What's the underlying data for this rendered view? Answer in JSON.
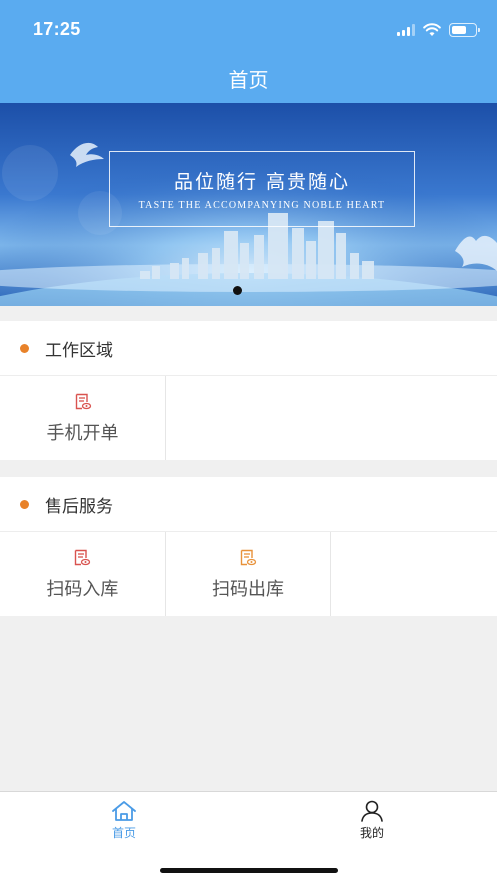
{
  "status_bar": {
    "time": "17:25"
  },
  "header": {
    "title": "首页"
  },
  "banner": {
    "title_cn": "品位随行  高贵随心",
    "subtitle_en": "TASTE THE ACCOMPANYING NOBLE HEART"
  },
  "sections": [
    {
      "title": "工作区域",
      "items": [
        {
          "label": "手机开单",
          "icon": "document-view-icon",
          "icon_color": "#d9534f"
        }
      ]
    },
    {
      "title": "售后服务",
      "items": [
        {
          "label": "扫码入库",
          "icon": "document-view-icon",
          "icon_color": "#d9534f"
        },
        {
          "label": "扫码出库",
          "icon": "document-view-icon",
          "icon_color": "#e8923a"
        }
      ]
    }
  ],
  "tabbar": {
    "items": [
      {
        "label": "首页",
        "icon": "home-icon",
        "active": true
      },
      {
        "label": "我的",
        "icon": "user-icon",
        "active": false
      }
    ]
  },
  "colors": {
    "primary": "#5aabf0",
    "accent_dot": "#e8822a",
    "tab_active": "#4a9be6"
  }
}
